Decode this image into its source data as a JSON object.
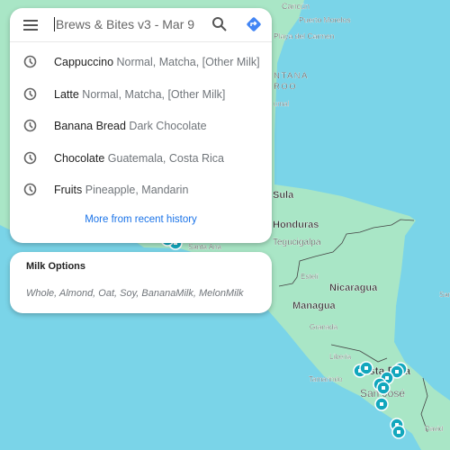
{
  "search": {
    "query": "Brews & Bites v3 - Mar 9",
    "menu_icon": "hamburger-menu-icon",
    "search_icon": "search-icon",
    "directions_icon": "directions-icon",
    "recent": [
      {
        "title": "Cappuccino",
        "detail": "Normal, Matcha, [Other Milk]"
      },
      {
        "title": "Latte",
        "detail": "Normal, Matcha, [Other Milk]"
      },
      {
        "title": "Banana Bread",
        "detail": "Dark Chocolate"
      },
      {
        "title": "Chocolate",
        "detail": "Guatemala, Costa Rica"
      },
      {
        "title": "Fruits",
        "detail": "Pineapple, Mandarin"
      }
    ],
    "more_label": "More from recent history"
  },
  "milk": {
    "title": "Milk Options",
    "options": "Whole, Almond, Oat, Soy, BananaMilk, MelonMilk"
  },
  "map": {
    "labels": {
      "cancun": "Cancún",
      "puerto_morelos": "Puerto Morelos",
      "playa": "Playa del Carmen",
      "quintana": "NTANA",
      "roo": "ROO",
      "tulum": "umal",
      "sula": "Sula",
      "honduras": "Honduras",
      "tegucigalpa": "Tegucigalpa",
      "santa_ana": "Santa Ana",
      "esteli": "Estelí",
      "nicaragua": "Nicaragua",
      "managua": "Managua",
      "granada": "Granada",
      "liberia": "Liberia",
      "tamarindo": "Tamarindo",
      "costa_rica": "Costa Rica",
      "san_jose": "San José",
      "david": "David",
      "san": "San"
    },
    "colors": {
      "water": "#7ad4e8",
      "land": "#a9e6c6",
      "marker": "#12a7bd"
    }
  }
}
